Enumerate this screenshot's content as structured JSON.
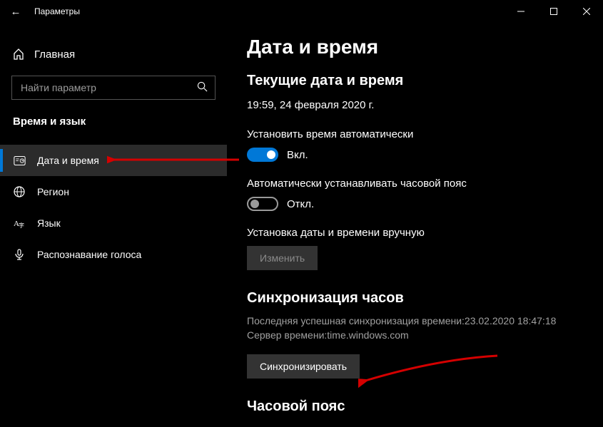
{
  "titlebar": {
    "app_name": "Параметры"
  },
  "sidebar": {
    "home_label": "Главная",
    "search_placeholder": "Найти параметр",
    "group_header": "Время и язык",
    "items": [
      {
        "label": "Дата и время"
      },
      {
        "label": "Регион"
      },
      {
        "label": "Язык"
      },
      {
        "label": "Распознавание голоса"
      }
    ]
  },
  "main": {
    "page_title": "Дата и время",
    "current_section_title": "Текущие дата и время",
    "current_datetime": "19:59, 24 февраля 2020 г.",
    "auto_time_label": "Установить время автоматически",
    "auto_time_state": "Вкл.",
    "auto_tz_label": "Автоматически устанавливать часовой пояс",
    "auto_tz_state": "Откл.",
    "manual_label": "Установка даты и времени вручную",
    "change_button": "Изменить",
    "sync_title": "Синхронизация часов",
    "sync_last": "Последняя успешная синхронизация времени:23.02.2020 18:47:18",
    "sync_server": "Сервер времени:time.windows.com",
    "sync_button": "Синхронизировать",
    "tz_title": "Часовой пояс"
  }
}
